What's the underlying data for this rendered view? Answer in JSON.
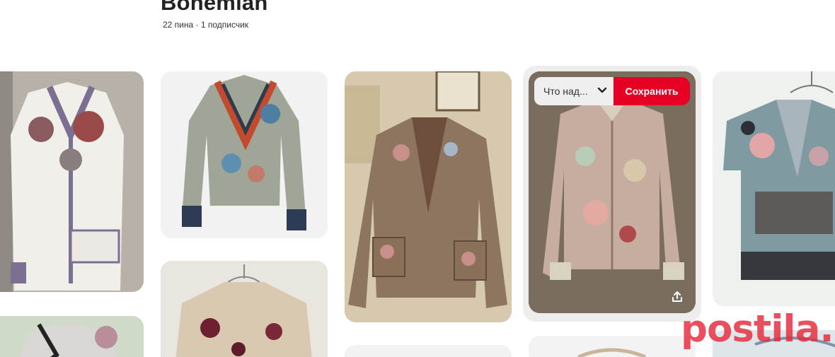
{
  "board": {
    "title": "Bohemian",
    "meta": "22 пина · 1 подписчик"
  },
  "hover_overlay": {
    "board_select_label": "Что над...",
    "save_label": "Сохранить"
  },
  "icons": {
    "dropdown": "chevron-down-icon",
    "share": "share-icon"
  },
  "watermark": "postila.ru",
  "colors": {
    "save_button": "#e60023",
    "watermark": "#e6283c"
  }
}
